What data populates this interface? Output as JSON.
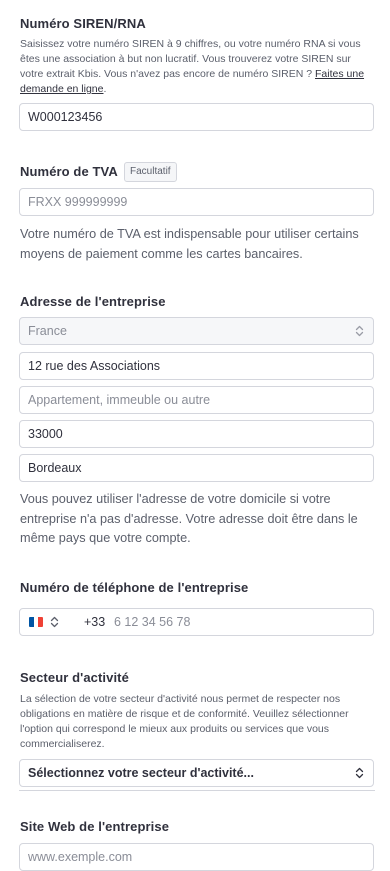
{
  "siren": {
    "label": "Numéro SIREN/RNA",
    "help_text": "Saisissez votre numéro SIREN à 9 chiffres, ou votre numéro RNA si vous êtes une association à but non lucratif. Vous trouverez votre SIREN sur votre extrait Kbis. Vous n'avez pas encore de numéro SIREN ? ",
    "help_link": "Faites une demande en ligne",
    "help_end": ".",
    "value": "W000123456"
  },
  "vat": {
    "label": "Numéro de TVA",
    "badge": "Facultatif",
    "placeholder": "FRXX 999999999",
    "note": "Votre numéro de TVA est indispensable pour utiliser certains moyens de paiement comme les cartes bancaires."
  },
  "address": {
    "label": "Adresse de l'entreprise",
    "country": "France",
    "street": "12 rue des Associations",
    "line2_placeholder": "Appartement, immeuble ou autre",
    "postal_code": "33000",
    "city": "Bordeaux",
    "note": "Vous pouvez utiliser l'adresse de votre domicile si votre entreprise n'a pas d'adresse. Votre adresse doit être dans le même pays que votre compte."
  },
  "phone": {
    "label": "Numéro de téléphone de l'entreprise",
    "dial_code": "+33",
    "placeholder": "6 12 34 56 78",
    "flag_colors": [
      "#0055a4",
      "#ffffff",
      "#ef4135"
    ]
  },
  "industry": {
    "label": "Secteur d'activité",
    "help_text": "La sélection de votre secteur d'activité nous permet de respecter nos obligations en matière de risque et de conformité. Veuillez sélectionner l'option qui correspond le mieux aux produits ou services que vous commercialiserez.",
    "select_text": "Sélectionnez votre secteur d'activité..."
  },
  "website": {
    "label": "Site Web de l'entreprise",
    "placeholder": "www.exemple.com"
  }
}
